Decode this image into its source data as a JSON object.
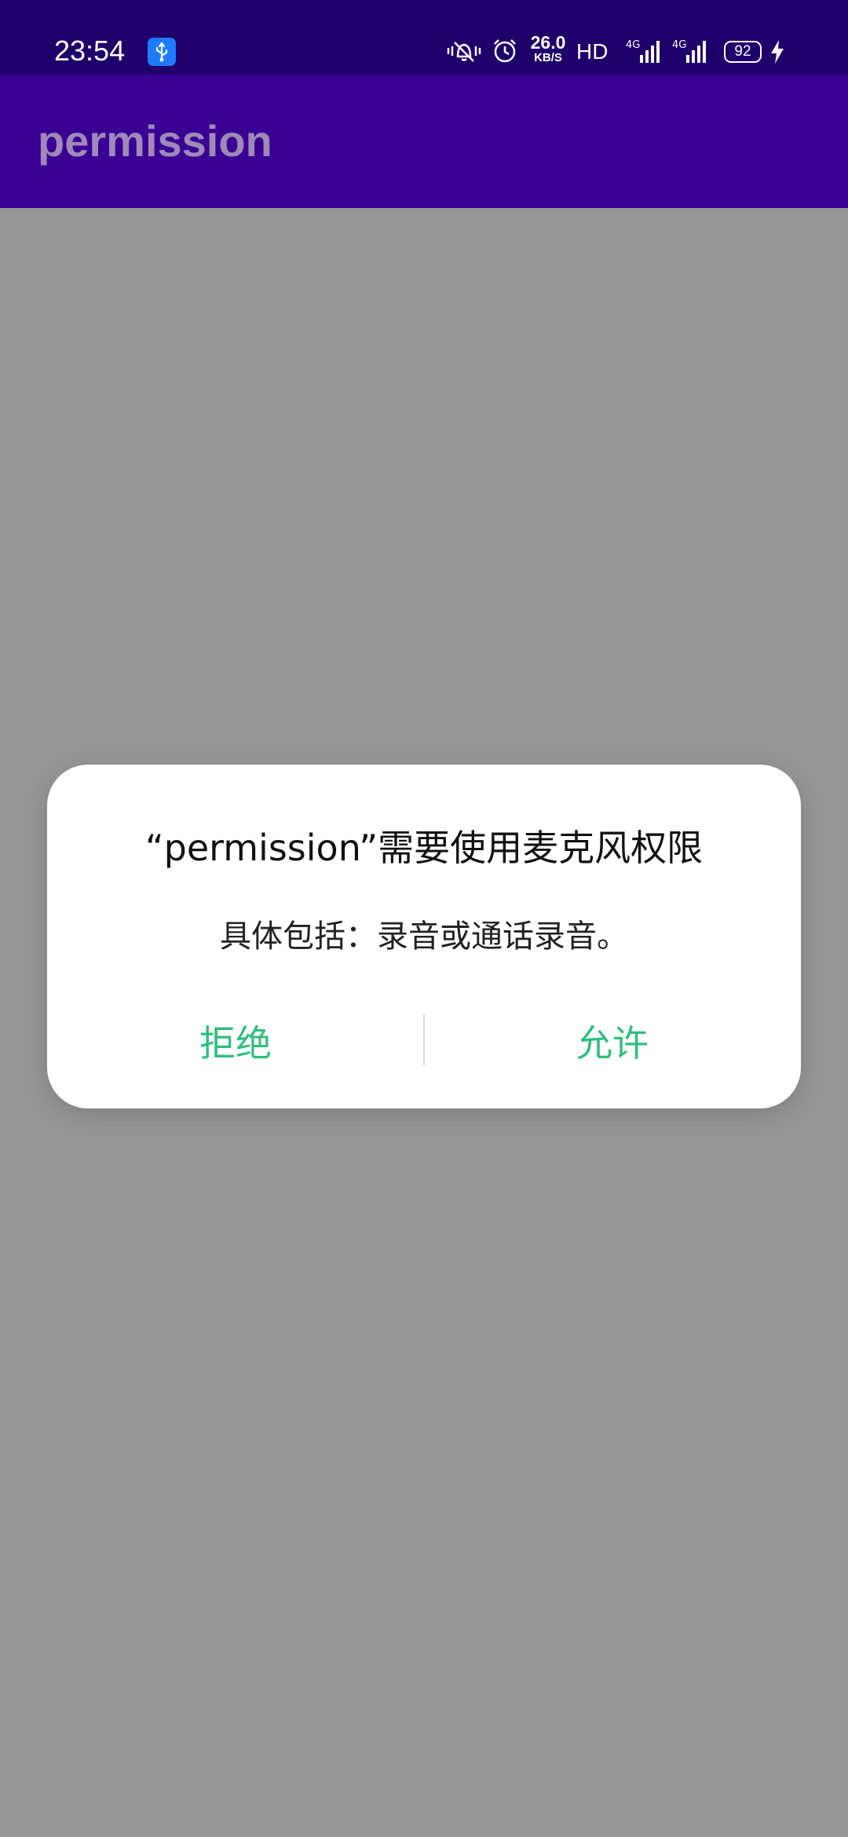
{
  "status_bar": {
    "time": "23:54",
    "net_speed_value": "26.0",
    "net_speed_unit": "KB/S",
    "hd_label": "HD",
    "battery_level": "92",
    "icons": [
      "usb-icon",
      "vibrate-icon",
      "alarm-icon",
      "signal-4g-icon",
      "signal-4g-icon",
      "battery-icon",
      "charging-icon"
    ]
  },
  "app_bar": {
    "title": "permission"
  },
  "dialog": {
    "title": "“permission”需要使用麦克风权限",
    "message": "具体包括：录音或通话录音。",
    "deny_label": "拒绝",
    "allow_label": "允许"
  },
  "colors": {
    "status_bar_bg": "#1f006a",
    "app_bar_bg": "#3a0094",
    "scrim_bg": "#969696",
    "button_text": "#2ebf7c"
  }
}
